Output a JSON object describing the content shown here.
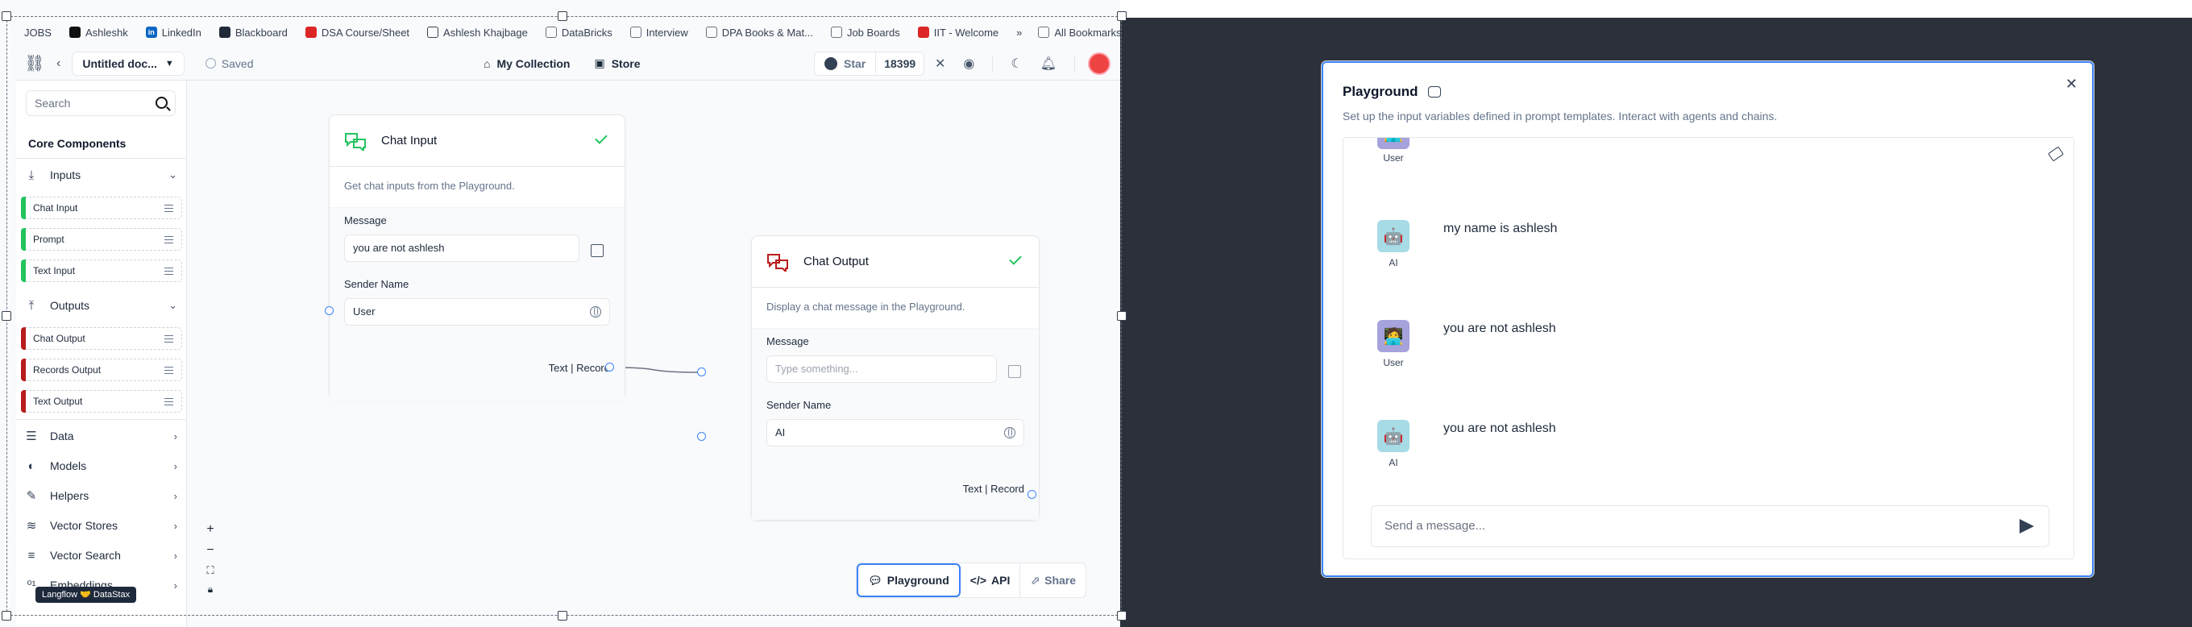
{
  "bookmarks": {
    "items": [
      {
        "label": "JOBS",
        "icon": "none"
      },
      {
        "label": "Ashleshk",
        "icon": "github-icon"
      },
      {
        "label": "LinkedIn",
        "icon": "linkedin-icon"
      },
      {
        "label": "Blackboard",
        "icon": "blackboard-icon"
      },
      {
        "label": "DSA Course/Sheet",
        "icon": "dsa-icon"
      },
      {
        "label": "Ashlesh Khajbage",
        "icon": "globe-icon"
      },
      {
        "label": "DataBricks",
        "icon": "folder-icon"
      },
      {
        "label": "Interview",
        "icon": "folder-icon"
      },
      {
        "label": "DPA Books & Mat...",
        "icon": "folder-icon"
      },
      {
        "label": "Job Boards",
        "icon": "folder-icon"
      },
      {
        "label": "IIT - Welcome",
        "icon": "iit-icon"
      }
    ],
    "more": "»",
    "all_bookmarks": "All Bookmarks"
  },
  "header": {
    "doc_name": "Untitled doc...",
    "saved": "Saved",
    "my_collection": "My Collection",
    "store": "Store",
    "star_label": "Star",
    "star_count": "18399"
  },
  "sidebar": {
    "search_placeholder": "Search",
    "core_title": "Core Components",
    "inputs_label": "Inputs",
    "input_items": [
      "Chat Input",
      "Prompt",
      "Text Input"
    ],
    "outputs_label": "Outputs",
    "output_items": [
      "Chat Output",
      "Records Output",
      "Text Output"
    ],
    "categories": [
      "Data",
      "Models",
      "Helpers",
      "Vector Stores",
      "Vector Search",
      "Embeddings"
    ],
    "badge": "Langflow 🤝 DataStax"
  },
  "chat_input_node": {
    "title": "Chat Input",
    "description": "Get chat inputs from the Playground.",
    "message_label": "Message",
    "message_value": "you are not ashlesh",
    "sender_label": "Sender Name",
    "sender_value": "User",
    "output_label": "Text | Record"
  },
  "chat_output_node": {
    "title": "Chat Output",
    "description": "Display a chat message in the Playground.",
    "message_label": "Message",
    "message_placeholder": "Type something...",
    "sender_label": "Sender Name",
    "sender_value": "AI",
    "output_label": "Text | Record"
  },
  "bottom_bar": {
    "playground": "Playground",
    "api": "API",
    "share": "Share"
  },
  "playground": {
    "title": "Playground",
    "subtitle": "Set up the input variables defined in prompt templates. Interact with agents and chains.",
    "messages": [
      {
        "sender": "User",
        "text": ""
      },
      {
        "sender": "AI",
        "text": "my name is ashlesh"
      },
      {
        "sender": "User",
        "text": "you are not ashlesh"
      },
      {
        "sender": "AI",
        "text": "you are not ashlesh"
      }
    ],
    "input_placeholder": "Send a message..."
  },
  "colors": {
    "accent": "#3b82f6",
    "input_green": "#22c55e",
    "output_red": "#b91c1c",
    "overlay": "#2b303a"
  }
}
